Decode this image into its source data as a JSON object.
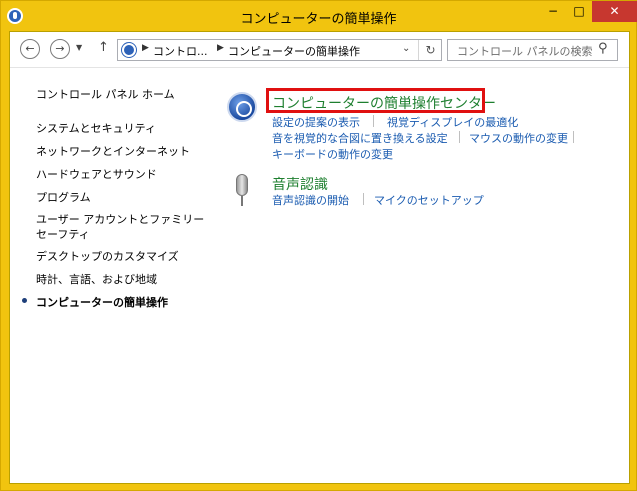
{
  "window": {
    "title": "コンピューターの簡単操作",
    "minimize_label": "−",
    "maximize_label": "□",
    "close_label": "✕"
  },
  "nav": {
    "back_icon": "arrow-left",
    "forward_icon": "arrow-right",
    "recent_icon": "chevron-down",
    "up_icon": "arrow-up"
  },
  "address": {
    "crumbs": [
      "コントロ...",
      "コンピューターの簡単操作"
    ],
    "refresh_icon": "refresh"
  },
  "search": {
    "placeholder": "コントロール パネルの検索",
    "icon": "magnifier"
  },
  "sidebar": {
    "home": "コントロール パネル ホーム",
    "items": [
      "システムとセキュリティ",
      "ネットワークとインターネット",
      "ハードウェアとサウンド",
      "プログラム",
      "ユーザー アカウントとファミリー セーフティ",
      "デスクトップのカスタマイズ",
      "時計、言語、および地域",
      "コンピューターの簡単操作"
    ],
    "current_index": 7
  },
  "sections": {
    "ease": {
      "icon": "ease-of-access-icon",
      "title": "コンピューターの簡単操作センター",
      "links": [
        "設定の提案の表示",
        "視覚ディスプレイの最適化",
        "音を視覚的な合図に置き換える設定",
        "マウスの動作の変更",
        "キーボードの動作の変更"
      ]
    },
    "speech": {
      "icon": "microphone-icon",
      "title": "音声認識",
      "links": [
        "音声認識の開始",
        "マイクのセットアップ"
      ]
    }
  },
  "colors": {
    "titlebar": "#f1c40f",
    "close_button": "#c7372f",
    "link": "#1a5bb0",
    "section_title": "#1e7f2f",
    "highlight": "#e01010"
  }
}
